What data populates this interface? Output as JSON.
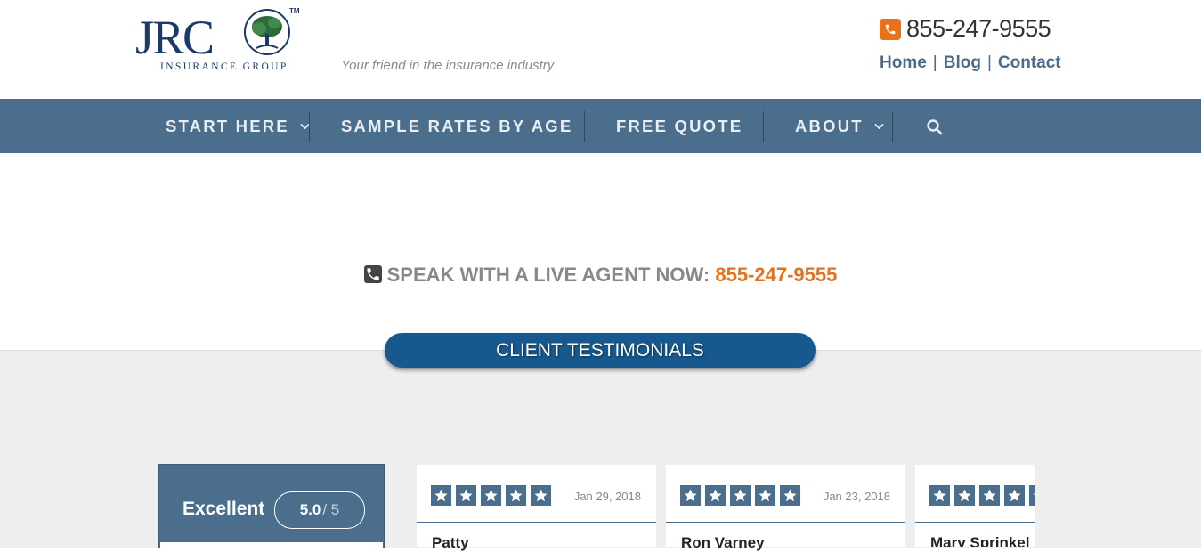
{
  "header": {
    "logo_text": "JRC",
    "logo_subtext": "INSURANCE GROUP",
    "logo_tm": "TM",
    "tagline": "Your friend in the insurance industry",
    "phone": "855-247-9555",
    "links": [
      "Home",
      "Blog",
      "Contact"
    ]
  },
  "nav": {
    "items": [
      {
        "label": "START HERE",
        "has_dropdown": true
      },
      {
        "label": "SAMPLE RATES BY AGE",
        "has_dropdown": false
      },
      {
        "label": "FREE QUOTE",
        "has_dropdown": false
      },
      {
        "label": "ABOUT",
        "has_dropdown": true
      }
    ],
    "search_icon": "search-icon"
  },
  "agent": {
    "label": "SPEAK WITH A LIVE AGENT NOW:",
    "phone": "855-247-9555"
  },
  "testimonials": {
    "button_label": "CLIENT TESTIMONIALS",
    "summary": {
      "label": "Excellent",
      "score": "5.0",
      "out_of": "/ 5"
    },
    "reviews": [
      {
        "date": "Jan 29, 2018",
        "name": "Patty",
        "stars": 5
      },
      {
        "date": "Jan 23, 2018",
        "name": "Ron Varney",
        "stars": 5
      },
      {
        "date": "",
        "name": "Mary Sprinkel",
        "stars": 5
      }
    ]
  },
  "colors": {
    "nav_bg": "#4a6e8b",
    "accent_orange": "#e8721c",
    "button_blue": "#17598f",
    "page_grey": "#eeeeee"
  }
}
